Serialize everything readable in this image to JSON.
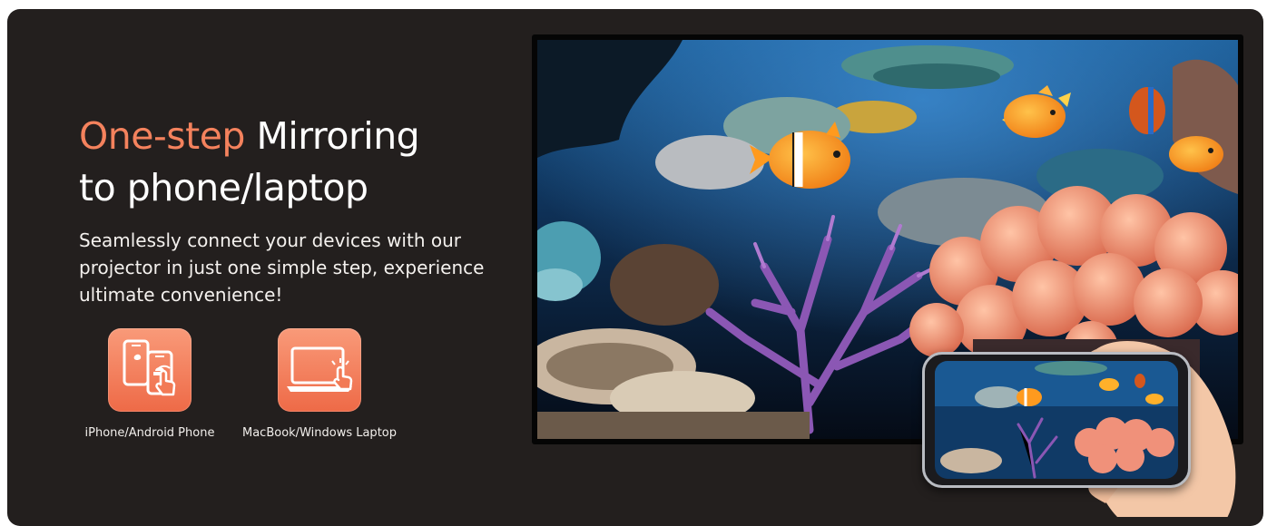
{
  "colors": {
    "accent": "#f4825d",
    "background": "#231f1e",
    "tile": "#f27a55"
  },
  "heading": {
    "accent_text": "One-step",
    "line1_rest": " Mirroring",
    "line2": "to phone/laptop"
  },
  "description": "Seamlessly connect your devices with our projector in just one simple step, experience ultimate convenience!",
  "devices": [
    {
      "label": "iPhone/Android Phone",
      "icon": "phone-mirroring-icon"
    },
    {
      "label": "MacBook/Windows Laptop",
      "icon": "laptop-mirroring-icon"
    }
  ],
  "media": {
    "scene": "underwater-coral-reef-image",
    "phone": "handheld-phone-image"
  }
}
